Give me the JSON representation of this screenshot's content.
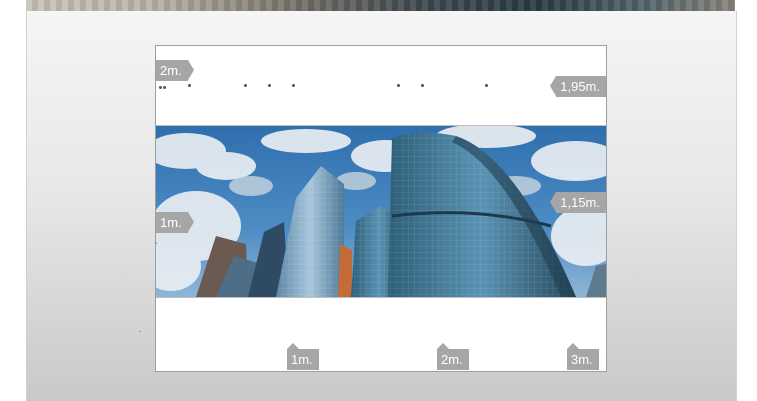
{
  "scene": {
    "background_color": "#ffffff",
    "panel_gradient": [
      "#f5f5f5",
      "#c9c9c9"
    ],
    "tag_color": "#a6a6a6",
    "card_border_color": "#9e9e9e"
  },
  "labels": {
    "height_left_top": "2m.",
    "height_right_top": "1,95m.",
    "height_left_mid": "1m.",
    "height_right_mid": "1,15m.",
    "width_1": "1m.",
    "width_2": "2m.",
    "width_3": "3m."
  },
  "photo": {
    "subject": "skyscrapers-under-cloudy-sky",
    "sky_color": "#2a6fb0",
    "glass_color": "#3f7fa6"
  }
}
